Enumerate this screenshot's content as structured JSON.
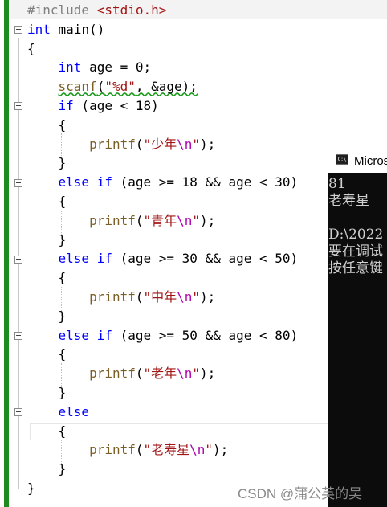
{
  "editor": {
    "lines": [
      {
        "tokens": [
          {
            "t": "#include ",
            "c": "inc"
          },
          {
            "t": "<stdio.h>",
            "c": "str"
          }
        ]
      },
      {
        "tokens": [
          {
            "t": "int",
            "c": "kw"
          },
          {
            "t": " main()",
            "c": ""
          }
        ]
      },
      {
        "tokens": [
          {
            "t": "{",
            "c": ""
          }
        ]
      },
      {
        "tokens": [
          {
            "t": "    ",
            "c": ""
          },
          {
            "t": "int",
            "c": "kw"
          },
          {
            "t": " age = 0;",
            "c": ""
          }
        ]
      },
      {
        "tokens": [
          {
            "t": "    ",
            "c": ""
          },
          {
            "t": "scanf",
            "c": "fn squig"
          },
          {
            "t": "(",
            "c": "squig"
          },
          {
            "t": "\"%d\"",
            "c": "str squig"
          },
          {
            "t": ", &age);",
            "c": "squig"
          }
        ]
      },
      {
        "tokens": [
          {
            "t": "    ",
            "c": ""
          },
          {
            "t": "if",
            "c": "kw"
          },
          {
            "t": " (age < 18)",
            "c": ""
          }
        ]
      },
      {
        "tokens": [
          {
            "t": "    {",
            "c": ""
          }
        ]
      },
      {
        "tokens": [
          {
            "t": "        ",
            "c": ""
          },
          {
            "t": "printf",
            "c": "fn"
          },
          {
            "t": "(",
            "c": ""
          },
          {
            "t": "\"少年",
            "c": "str"
          },
          {
            "t": "\\n",
            "c": "esc"
          },
          {
            "t": "\"",
            "c": "str"
          },
          {
            "t": ");",
            "c": ""
          }
        ]
      },
      {
        "tokens": [
          {
            "t": "    }",
            "c": ""
          }
        ]
      },
      {
        "tokens": [
          {
            "t": "    ",
            "c": ""
          },
          {
            "t": "else if",
            "c": "kw"
          },
          {
            "t": " (age >= 18 && age < 30)",
            "c": ""
          }
        ]
      },
      {
        "tokens": [
          {
            "t": "    {",
            "c": ""
          }
        ]
      },
      {
        "tokens": [
          {
            "t": "        ",
            "c": ""
          },
          {
            "t": "printf",
            "c": "fn"
          },
          {
            "t": "(",
            "c": ""
          },
          {
            "t": "\"青年",
            "c": "str"
          },
          {
            "t": "\\n",
            "c": "esc"
          },
          {
            "t": "\"",
            "c": "str"
          },
          {
            "t": ");",
            "c": ""
          }
        ]
      },
      {
        "tokens": [
          {
            "t": "    }",
            "c": ""
          }
        ]
      },
      {
        "tokens": [
          {
            "t": "    ",
            "c": ""
          },
          {
            "t": "else if",
            "c": "kw"
          },
          {
            "t": " (age >= 30 && age < 50)",
            "c": ""
          }
        ]
      },
      {
        "tokens": [
          {
            "t": "    {",
            "c": ""
          }
        ]
      },
      {
        "tokens": [
          {
            "t": "        ",
            "c": ""
          },
          {
            "t": "printf",
            "c": "fn"
          },
          {
            "t": "(",
            "c": ""
          },
          {
            "t": "\"中年",
            "c": "str"
          },
          {
            "t": "\\n",
            "c": "esc"
          },
          {
            "t": "\"",
            "c": "str"
          },
          {
            "t": ");",
            "c": ""
          }
        ]
      },
      {
        "tokens": [
          {
            "t": "    }",
            "c": ""
          }
        ]
      },
      {
        "tokens": [
          {
            "t": "    ",
            "c": ""
          },
          {
            "t": "else if",
            "c": "kw"
          },
          {
            "t": " (age >= 50 && age < 80)",
            "c": ""
          }
        ]
      },
      {
        "tokens": [
          {
            "t": "    {",
            "c": ""
          }
        ]
      },
      {
        "tokens": [
          {
            "t": "        ",
            "c": ""
          },
          {
            "t": "printf",
            "c": "fn"
          },
          {
            "t": "(",
            "c": ""
          },
          {
            "t": "\"老年",
            "c": "str"
          },
          {
            "t": "\\n",
            "c": "esc"
          },
          {
            "t": "\"",
            "c": "str"
          },
          {
            "t": ");",
            "c": ""
          }
        ]
      },
      {
        "tokens": [
          {
            "t": "    }",
            "c": ""
          }
        ]
      },
      {
        "tokens": [
          {
            "t": "    ",
            "c": ""
          },
          {
            "t": "else",
            "c": "kw"
          }
        ]
      },
      {
        "tokens": [
          {
            "t": "    {",
            "c": ""
          }
        ]
      },
      {
        "tokens": [
          {
            "t": "        ",
            "c": ""
          },
          {
            "t": "printf",
            "c": "fn"
          },
          {
            "t": "(",
            "c": ""
          },
          {
            "t": "\"老寿星",
            "c": "str"
          },
          {
            "t": "\\n",
            "c": "esc"
          },
          {
            "t": "\"",
            "c": "str"
          },
          {
            "t": ");",
            "c": ""
          }
        ]
      },
      {
        "tokens": [
          {
            "t": "    }",
            "c": ""
          }
        ]
      },
      {
        "tokens": [
          {
            "t": "}",
            "c": ""
          }
        ]
      }
    ]
  },
  "console": {
    "title": "Microsoft Visual Studio 调试控制台",
    "icon": "console-window-icon",
    "output_lines": [
      "81",
      "老寿星",
      "",
      "D:\\2022",
      "要在调试",
      "按任意键"
    ]
  },
  "watermark": "CSDN @蒲公英的吴"
}
